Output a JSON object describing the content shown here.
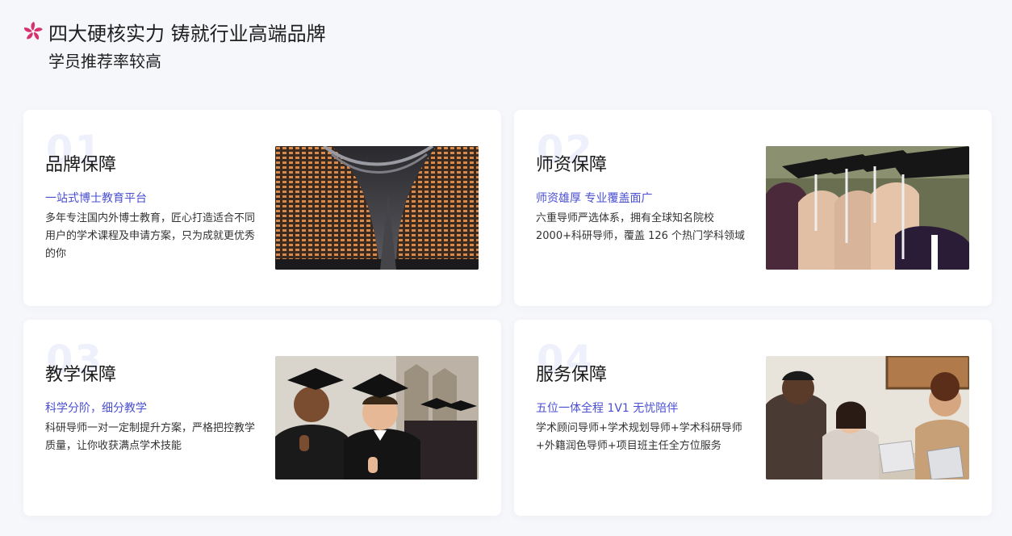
{
  "header": {
    "logo_icon": "bauhinia-flower-icon",
    "title": "四大硬核实力 铸就行业高端品牌",
    "subtitle": "学员推荐率较高"
  },
  "cards": [
    {
      "number": "01",
      "heading": "品牌保障",
      "tagline": "一站式博士教育平台",
      "description": "多年专注国内外博士教育，匠心打造适合不同用户的学术课程及申请方案，只为成就更优秀的你",
      "image": "modern-building-night-photo"
    },
    {
      "number": "02",
      "heading": "师资保障",
      "tagline": "师资雄厚 专业覆盖面广",
      "description": "六重导师严选体系，拥有全球知名院校2000+科研导师，覆盖 126 个热门学科领域",
      "image": "graduates-caps-tassels-photo"
    },
    {
      "number": "03",
      "heading": "教学保障",
      "tagline": "科学分阶，细分教学",
      "description": "科研导师一对一定制提升方案，严格把控教学质量，让你收获满点学术技能",
      "image": "smiling-graduates-thumbs-up-photo"
    },
    {
      "number": "04",
      "heading": "服务保障",
      "tagline": "五位一体全程 1V1 无忧陪伴",
      "description": "学术顾问导师+学术规划导师+学术科研导师+外籍润色导师+项目班主任全方位服务",
      "image": "team-working-laptops-photo"
    }
  ],
  "colors": {
    "accent": "#4a4fd1",
    "logo": "#d6336c",
    "background": "#f6f7fb",
    "number_watermark": "#eef0fb"
  }
}
